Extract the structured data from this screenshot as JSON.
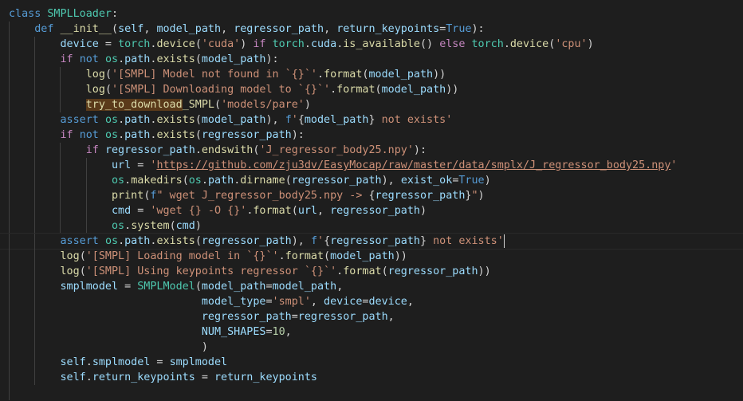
{
  "code": {
    "lines": [
      {
        "indent": 0,
        "tokens": [
          [
            "kw",
            "class"
          ],
          [
            "plain",
            " "
          ],
          [
            "cls",
            "SMPLLoader"
          ],
          [
            "plain",
            ":"
          ]
        ]
      },
      {
        "indent": 1,
        "tokens": [
          [
            "kw",
            "def"
          ],
          [
            "plain",
            " "
          ],
          [
            "fn",
            "__init__"
          ],
          [
            "plain",
            "("
          ],
          [
            "var",
            "self"
          ],
          [
            "plain",
            ", "
          ],
          [
            "var",
            "model_path"
          ],
          [
            "plain",
            ", "
          ],
          [
            "var",
            "regressor_path"
          ],
          [
            "plain",
            ", "
          ],
          [
            "var",
            "return_keypoints"
          ],
          [
            "plain",
            "="
          ],
          [
            "kw",
            "True"
          ],
          [
            "plain",
            "):"
          ]
        ]
      },
      {
        "indent": 2,
        "tokens": [
          [
            "var",
            "device"
          ],
          [
            "plain",
            " = "
          ],
          [
            "cls",
            "torch"
          ],
          [
            "plain",
            "."
          ],
          [
            "fn",
            "device"
          ],
          [
            "plain",
            "("
          ],
          [
            "str",
            "'cuda'"
          ],
          [
            "plain",
            ") "
          ],
          [
            "ctl",
            "if"
          ],
          [
            "plain",
            " "
          ],
          [
            "cls",
            "torch"
          ],
          [
            "plain",
            "."
          ],
          [
            "var",
            "cuda"
          ],
          [
            "plain",
            "."
          ],
          [
            "fn",
            "is_available"
          ],
          [
            "plain",
            "() "
          ],
          [
            "ctl",
            "else"
          ],
          [
            "plain",
            " "
          ],
          [
            "cls",
            "torch"
          ],
          [
            "plain",
            "."
          ],
          [
            "fn",
            "device"
          ],
          [
            "plain",
            "("
          ],
          [
            "str",
            "'cpu'"
          ],
          [
            "plain",
            ")"
          ]
        ]
      },
      {
        "indent": 2,
        "tokens": [
          [
            "ctl",
            "if"
          ],
          [
            "plain",
            " "
          ],
          [
            "kw",
            "not"
          ],
          [
            "plain",
            " "
          ],
          [
            "cls",
            "os"
          ],
          [
            "plain",
            "."
          ],
          [
            "var",
            "path"
          ],
          [
            "plain",
            "."
          ],
          [
            "fn",
            "exists"
          ],
          [
            "plain",
            "("
          ],
          [
            "var",
            "model_path"
          ],
          [
            "plain",
            "):"
          ]
        ]
      },
      {
        "indent": 3,
        "tokens": [
          [
            "fn",
            "log"
          ],
          [
            "plain",
            "("
          ],
          [
            "str",
            "'[SMPL] Model not found in `{}`'"
          ],
          [
            "plain",
            "."
          ],
          [
            "fn",
            "format"
          ],
          [
            "plain",
            "("
          ],
          [
            "var",
            "model_path"
          ],
          [
            "plain",
            "))"
          ]
        ]
      },
      {
        "indent": 3,
        "tokens": [
          [
            "fn",
            "log"
          ],
          [
            "plain",
            "("
          ],
          [
            "str",
            "'[SMPL] Downloading model to `{}`'"
          ],
          [
            "plain",
            "."
          ],
          [
            "fn",
            "format"
          ],
          [
            "plain",
            "("
          ],
          [
            "var",
            "model_path"
          ],
          [
            "plain",
            "))"
          ]
        ]
      },
      {
        "indent": 3,
        "tokens": [
          [
            "fn hl",
            "try_to_download"
          ],
          [
            "fn",
            "_SMPL"
          ],
          [
            "plain",
            "("
          ],
          [
            "str",
            "'models/pare'"
          ],
          [
            "plain",
            ")"
          ]
        ]
      },
      {
        "indent": 2,
        "tokens": [
          [
            "kw",
            "assert"
          ],
          [
            "plain",
            " "
          ],
          [
            "cls",
            "os"
          ],
          [
            "plain",
            "."
          ],
          [
            "var",
            "path"
          ],
          [
            "plain",
            "."
          ],
          [
            "fn",
            "exists"
          ],
          [
            "plain",
            "("
          ],
          [
            "var",
            "model_path"
          ],
          [
            "plain",
            "), "
          ],
          [
            "kw",
            "f"
          ],
          [
            "str",
            "'"
          ],
          [
            "plain",
            "{"
          ],
          [
            "var",
            "model_path"
          ],
          [
            "plain",
            "}"
          ],
          [
            "str",
            " not exists'"
          ]
        ]
      },
      {
        "indent": 2,
        "tokens": [
          [
            "ctl",
            "if"
          ],
          [
            "plain",
            " "
          ],
          [
            "kw",
            "not"
          ],
          [
            "plain",
            " "
          ],
          [
            "cls",
            "os"
          ],
          [
            "plain",
            "."
          ],
          [
            "var",
            "path"
          ],
          [
            "plain",
            "."
          ],
          [
            "fn",
            "exists"
          ],
          [
            "plain",
            "("
          ],
          [
            "var",
            "regressor_path"
          ],
          [
            "plain",
            "):"
          ]
        ]
      },
      {
        "indent": 3,
        "tokens": [
          [
            "ctl",
            "if"
          ],
          [
            "plain",
            " "
          ],
          [
            "var",
            "regressor_path"
          ],
          [
            "plain",
            "."
          ],
          [
            "fn",
            "endswith"
          ],
          [
            "plain",
            "("
          ],
          [
            "str",
            "'J_regressor_body25.npy'"
          ],
          [
            "plain",
            "):"
          ]
        ]
      },
      {
        "indent": 4,
        "tokens": [
          [
            "var",
            "url"
          ],
          [
            "plain",
            " = "
          ],
          [
            "str",
            "'"
          ],
          [
            "str link",
            "https://github.com/zju3dv/EasyMocap/raw/master/data/smplx/J_regressor_body25.npy"
          ],
          [
            "str",
            "'"
          ]
        ]
      },
      {
        "indent": 4,
        "tokens": [
          [
            "cls",
            "os"
          ],
          [
            "plain",
            "."
          ],
          [
            "fn",
            "makedirs"
          ],
          [
            "plain",
            "("
          ],
          [
            "cls",
            "os"
          ],
          [
            "plain",
            "."
          ],
          [
            "var",
            "path"
          ],
          [
            "plain",
            "."
          ],
          [
            "fn",
            "dirname"
          ],
          [
            "plain",
            "("
          ],
          [
            "var",
            "regressor_path"
          ],
          [
            "plain",
            "), "
          ],
          [
            "var",
            "exist_ok"
          ],
          [
            "plain",
            "="
          ],
          [
            "kw",
            "True"
          ],
          [
            "plain",
            ")"
          ]
        ]
      },
      {
        "indent": 4,
        "tokens": [
          [
            "fn",
            "print"
          ],
          [
            "plain",
            "("
          ],
          [
            "kw",
            "f"
          ],
          [
            "str",
            "\" wget J_regressor_body25.npy -> "
          ],
          [
            "plain",
            "{"
          ],
          [
            "var",
            "regressor_path"
          ],
          [
            "plain",
            "}"
          ],
          [
            "str",
            "\""
          ],
          [
            "plain",
            ")"
          ]
        ]
      },
      {
        "indent": 4,
        "tokens": [
          [
            "var",
            "cmd"
          ],
          [
            "plain",
            " = "
          ],
          [
            "str",
            "'wget {} -O {}'"
          ],
          [
            "plain",
            "."
          ],
          [
            "fn",
            "format"
          ],
          [
            "plain",
            "("
          ],
          [
            "var",
            "url"
          ],
          [
            "plain",
            ", "
          ],
          [
            "var",
            "regressor_path"
          ],
          [
            "plain",
            ")"
          ]
        ]
      },
      {
        "indent": 4,
        "tokens": [
          [
            "cls",
            "os"
          ],
          [
            "plain",
            "."
          ],
          [
            "fn",
            "system"
          ],
          [
            "plain",
            "("
          ],
          [
            "var",
            "cmd"
          ],
          [
            "plain",
            ")"
          ]
        ]
      },
      {
        "indent": 2,
        "current": true,
        "tokens": [
          [
            "kw",
            "assert"
          ],
          [
            "plain",
            " "
          ],
          [
            "cls",
            "os"
          ],
          [
            "plain",
            "."
          ],
          [
            "var",
            "path"
          ],
          [
            "plain",
            "."
          ],
          [
            "fn",
            "exists"
          ],
          [
            "plain",
            "("
          ],
          [
            "var",
            "regressor_path"
          ],
          [
            "plain",
            "), "
          ],
          [
            "kw",
            "f"
          ],
          [
            "str",
            "'"
          ],
          [
            "plain",
            "{"
          ],
          [
            "var",
            "regressor_path"
          ],
          [
            "plain",
            "}"
          ],
          [
            "str",
            " not exists'"
          ]
        ]
      },
      {
        "indent": 2,
        "tokens": [
          [
            "fn",
            "log"
          ],
          [
            "plain",
            "("
          ],
          [
            "str",
            "'[SMPL] Loading model in `{}`'"
          ],
          [
            "plain",
            "."
          ],
          [
            "fn",
            "format"
          ],
          [
            "plain",
            "("
          ],
          [
            "var",
            "model_path"
          ],
          [
            "plain",
            "))"
          ]
        ]
      },
      {
        "indent": 2,
        "tokens": [
          [
            "fn",
            "log"
          ],
          [
            "plain",
            "("
          ],
          [
            "str",
            "'[SMPL] Using keypoints regressor `{}`'"
          ],
          [
            "plain",
            "."
          ],
          [
            "fn",
            "format"
          ],
          [
            "plain",
            "("
          ],
          [
            "var",
            "regressor_path"
          ],
          [
            "plain",
            "))"
          ]
        ]
      },
      {
        "indent": 2,
        "tokens": [
          [
            "var",
            "smplmodel"
          ],
          [
            "plain",
            " = "
          ],
          [
            "cls",
            "SMPLModel"
          ],
          [
            "plain",
            "("
          ],
          [
            "var",
            "model_path"
          ],
          [
            "plain",
            "="
          ],
          [
            "var",
            "model_path"
          ],
          [
            "plain",
            ","
          ]
        ]
      },
      {
        "indent": 2,
        "pad": 22,
        "tokens": [
          [
            "var",
            "model_type"
          ],
          [
            "plain",
            "="
          ],
          [
            "str",
            "'smpl'"
          ],
          [
            "plain",
            ", "
          ],
          [
            "var",
            "device"
          ],
          [
            "plain",
            "="
          ],
          [
            "var",
            "device"
          ],
          [
            "plain",
            ","
          ]
        ]
      },
      {
        "indent": 2,
        "pad": 22,
        "tokens": [
          [
            "var",
            "regressor_path"
          ],
          [
            "plain",
            "="
          ],
          [
            "var",
            "regressor_path"
          ],
          [
            "plain",
            ","
          ]
        ]
      },
      {
        "indent": 2,
        "pad": 22,
        "tokens": [
          [
            "var",
            "NUM_SHAPES"
          ],
          [
            "plain",
            "="
          ],
          [
            "num",
            "10"
          ],
          [
            "plain",
            ","
          ]
        ]
      },
      {
        "indent": 2,
        "pad": 22,
        "tokens": [
          [
            "plain",
            ")"
          ]
        ]
      },
      {
        "indent": 2,
        "tokens": [
          [
            "var",
            "self"
          ],
          [
            "plain",
            "."
          ],
          [
            "var",
            "smplmodel"
          ],
          [
            "plain",
            " = "
          ],
          [
            "var",
            "smplmodel"
          ]
        ]
      },
      {
        "indent": 2,
        "tokens": [
          [
            "var",
            "self"
          ],
          [
            "plain",
            "."
          ],
          [
            "var",
            "return_keypoints"
          ],
          [
            "plain",
            " = "
          ],
          [
            "var",
            "return_keypoints"
          ]
        ]
      },
      {
        "indent": 1,
        "tokens": []
      }
    ]
  }
}
